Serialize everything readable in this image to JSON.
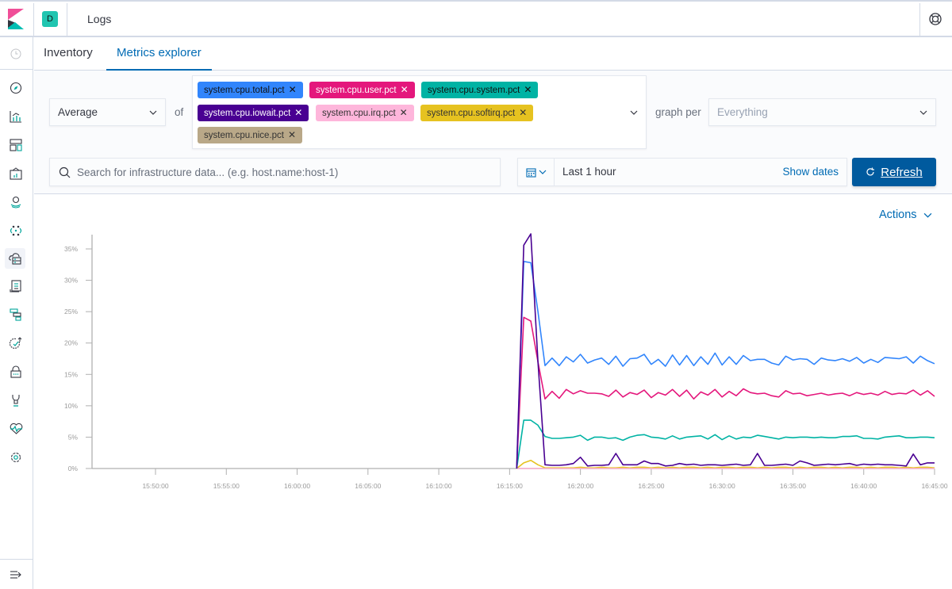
{
  "header": {
    "space_initial": "D",
    "app_title": "Logs",
    "space_color": "#20c5b0"
  },
  "sidebar": {
    "items": [
      {
        "name": "recently-viewed",
        "icon": "clock-icon"
      },
      {
        "name": "discover",
        "icon": "compass-icon"
      },
      {
        "name": "visualize",
        "icon": "visualize-icon"
      },
      {
        "name": "dashboard",
        "icon": "dashboard-icon"
      },
      {
        "name": "canvas",
        "icon": "canvas-icon"
      },
      {
        "name": "maps",
        "icon": "maps-icon"
      },
      {
        "name": "machine-learning",
        "icon": "ml-icon"
      },
      {
        "name": "infrastructure",
        "icon": "infrastructure-icon",
        "active": true
      },
      {
        "name": "logs",
        "icon": "logs-icon"
      },
      {
        "name": "apm",
        "icon": "apm-icon"
      },
      {
        "name": "uptime",
        "icon": "uptime-icon"
      },
      {
        "name": "siem",
        "icon": "lock-icon"
      },
      {
        "name": "dev-tools",
        "icon": "wrench-icon"
      },
      {
        "name": "monitoring",
        "icon": "heartbeat-icon"
      },
      {
        "name": "management",
        "icon": "gear-icon"
      }
    ],
    "collapse_icon": "collapse-menu-icon"
  },
  "tabs": [
    {
      "label": "Inventory",
      "active": false
    },
    {
      "label": "Metrics explorer",
      "active": true
    }
  ],
  "toolbar": {
    "aggregation": "Average",
    "of_label": "of",
    "metrics": [
      {
        "label": "system.cpu.total.pct",
        "color": "#3185fc",
        "text": "#111111"
      },
      {
        "label": "system.cpu.user.pct",
        "color": "#e4177c",
        "text": "#ffffff"
      },
      {
        "label": "system.cpu.system.pct",
        "color": "#00b3a4",
        "text": "#111111"
      },
      {
        "label": "system.cpu.iowait.pct",
        "color": "#490092",
        "text": "#ffffff"
      },
      {
        "label": "system.cpu.irq.pct",
        "color": "#feb6db",
        "text": "#333333"
      },
      {
        "label": "system.cpu.softirq.pct",
        "color": "#e6c220",
        "text": "#333333"
      },
      {
        "label": "system.cpu.nice.pct",
        "color": "#b9a888",
        "text": "#333333"
      }
    ],
    "graph_per_label": "graph per",
    "graph_per_placeholder": "Everything",
    "search_placeholder": "Search for infrastructure data... (e.g. host.name:host-1)",
    "search_value": "",
    "time_range": "Last 1 hour",
    "show_dates": "Show dates",
    "refresh_label": "Refresh",
    "actions_label": "Actions"
  },
  "chart_data": {
    "type": "line",
    "title": "",
    "xlabel": "",
    "ylabel": "",
    "x_range": [
      "15:45:30",
      "16:45:00"
    ],
    "ylim": [
      0,
      36
    ],
    "y_ticks": [
      "0%",
      "5%",
      "10%",
      "15%",
      "20%",
      "25%",
      "30%",
      "35%"
    ],
    "y_tick_values": [
      0,
      5,
      10,
      15,
      20,
      25,
      30,
      35
    ],
    "x_ticks": [
      "15:50:00",
      "15:55:00",
      "16:00:00",
      "16:05:00",
      "16:10:00",
      "16:15:00",
      "16:20:00",
      "16:25:00",
      "16:30:00",
      "16:35:00",
      "16:40:00",
      "16:45:00"
    ],
    "x_start": "16:15:30",
    "x_interval_seconds": 30,
    "grid": false,
    "legend": "none",
    "series": [
      {
        "name": "system.cpu.total.pct",
        "color": "#3185fc",
        "values": [
          0,
          33.0,
          32.8,
          25.0,
          16.4,
          17.6,
          16.4,
          17.8,
          17.0,
          18.2,
          16.8,
          17.3,
          17.6,
          16.6,
          17.9,
          16.3,
          17.5,
          17.6,
          18.2,
          16.6,
          17.4,
          16.3,
          18.1,
          16.5,
          18.0,
          16.4,
          17.8,
          16.6,
          18.4,
          16.5,
          17.8,
          16.6,
          18.0,
          17.2,
          17.4,
          17.4,
          16.8,
          16.5,
          17.9,
          17.3,
          17.5,
          17.4,
          16.6,
          17.6,
          17.3,
          17.2,
          17.5,
          17.1,
          17.7,
          16.8,
          17.4,
          16.9,
          17.7,
          17.6,
          17.5,
          17.8,
          16.8,
          17.9,
          17.2,
          16.7
        ]
      },
      {
        "name": "system.cpu.user.pct",
        "color": "#e4177c",
        "values": [
          0,
          24.1,
          23.5,
          17.0,
          11.1,
          12.3,
          11.2,
          12.6,
          11.9,
          12.4,
          12.0,
          12.0,
          11.9,
          11.5,
          12.5,
          11.4,
          12.1,
          11.8,
          12.5,
          11.3,
          12.1,
          11.7,
          12.6,
          11.5,
          12.5,
          11.1,
          12.2,
          11.7,
          12.6,
          11.4,
          12.3,
          11.6,
          12.7,
          12.1,
          11.9,
          12.0,
          11.6,
          11.4,
          12.4,
          11.9,
          12.0,
          11.6,
          11.8,
          12.0,
          11.7,
          11.9,
          12.0,
          11.6,
          12.1,
          11.8,
          12.0,
          11.7,
          12.3,
          11.8,
          12.0,
          11.9,
          12.5,
          11.7,
          12.4,
          11.5
        ]
      },
      {
        "name": "system.cpu.system.pct",
        "color": "#00b3a4",
        "values": [
          0,
          7.7,
          7.7,
          6.9,
          5.1,
          4.8,
          4.8,
          4.9,
          5.0,
          5.3,
          4.5,
          5.0,
          5.0,
          4.8,
          4.9,
          4.5,
          5.0,
          5.3,
          5.4,
          5.0,
          4.9,
          4.7,
          5.2,
          4.7,
          5.0,
          5.1,
          5.2,
          4.7,
          5.4,
          4.6,
          5.2,
          4.7,
          5.0,
          4.9,
          5.3,
          5.1,
          4.9,
          4.7,
          5.0,
          4.9,
          5.0,
          5.0,
          4.9,
          5.0,
          4.9,
          4.9,
          5.1,
          5.1,
          5.2,
          4.8,
          4.8,
          4.7,
          5.0,
          5.1,
          5.2,
          4.9,
          4.9,
          5.0,
          5.0,
          4.9
        ]
      },
      {
        "name": "system.cpu.iowait.pct",
        "color": "#490092",
        "values": [
          0,
          35.6,
          37.4,
          17.0,
          0.6,
          0.5,
          0.5,
          0.6,
          0.8,
          1.8,
          0.4,
          0.5,
          0.5,
          0.6,
          2.4,
          0.6,
          0.6,
          0.6,
          1.2,
          0.8,
          0.8,
          0.4,
          0.5,
          0.8,
          0.6,
          0.7,
          0.5,
          0.6,
          0.6,
          0.5,
          0.6,
          0.7,
          0.5,
          0.6,
          2.4,
          0.5,
          0.5,
          0.6,
          0.7,
          0.5,
          1.2,
          0.9,
          0.5,
          0.6,
          0.7,
          0.6,
          0.7,
          0.8,
          0.5,
          0.7,
          0.6,
          0.7,
          0.6,
          0.6,
          0.5,
          0.4,
          2.3,
          0.6,
          0.9,
          0.9
        ]
      },
      {
        "name": "system.cpu.irq.pct",
        "color": "#feb6db",
        "values": [
          0,
          0,
          0,
          0,
          0,
          0,
          0,
          0,
          0,
          0,
          0,
          0,
          0,
          0,
          0,
          0,
          0,
          0,
          0,
          0,
          0,
          0,
          0,
          0,
          0,
          0,
          0,
          0,
          0,
          0,
          0,
          0,
          0,
          0,
          0,
          0,
          0,
          0,
          0,
          0,
          0,
          0,
          0,
          0,
          0,
          0,
          0,
          0,
          0,
          0,
          0,
          0,
          0,
          0,
          0,
          0,
          0,
          0,
          0,
          0
        ]
      },
      {
        "name": "system.cpu.softirq.pct",
        "color": "#e6c220",
        "values": [
          0,
          0.9,
          1.3,
          0.6,
          0.1,
          0.1,
          0.1,
          0.1,
          0.1,
          0.2,
          0.1,
          0.1,
          0.2,
          0.1,
          0.1,
          0.2,
          0.1,
          0.2,
          0.2,
          0.1,
          0.2,
          0.1,
          0.2,
          0.1,
          0.2,
          0.2,
          0.1,
          0.2,
          0.1,
          0.2,
          0.2,
          0.1,
          0.2,
          0.2,
          0.1,
          0.2,
          0.1,
          0.2,
          0.2,
          0.1,
          0.2,
          0.1,
          0.2,
          0.2,
          0.1,
          0.2,
          0.1,
          0.2,
          0.2,
          0.1,
          0.2,
          0.1,
          0.2,
          0.2,
          0.1,
          0.2,
          0.1,
          0.2,
          0.2,
          0.1
        ]
      },
      {
        "name": "system.cpu.nice.pct",
        "color": "#b9a888",
        "values": [
          0,
          0,
          0,
          0,
          0,
          0,
          0,
          0,
          0,
          0,
          0,
          0,
          0,
          0,
          0,
          0,
          0,
          0,
          0,
          0,
          0,
          0,
          0,
          0,
          0,
          0,
          0,
          0,
          0,
          0,
          0,
          0,
          0,
          0,
          0,
          0,
          0,
          0,
          0,
          0,
          0,
          0,
          0,
          0,
          0,
          0,
          0,
          0,
          0,
          0,
          0,
          0,
          0,
          0,
          0,
          0,
          0,
          0,
          0,
          0
        ]
      }
    ]
  }
}
